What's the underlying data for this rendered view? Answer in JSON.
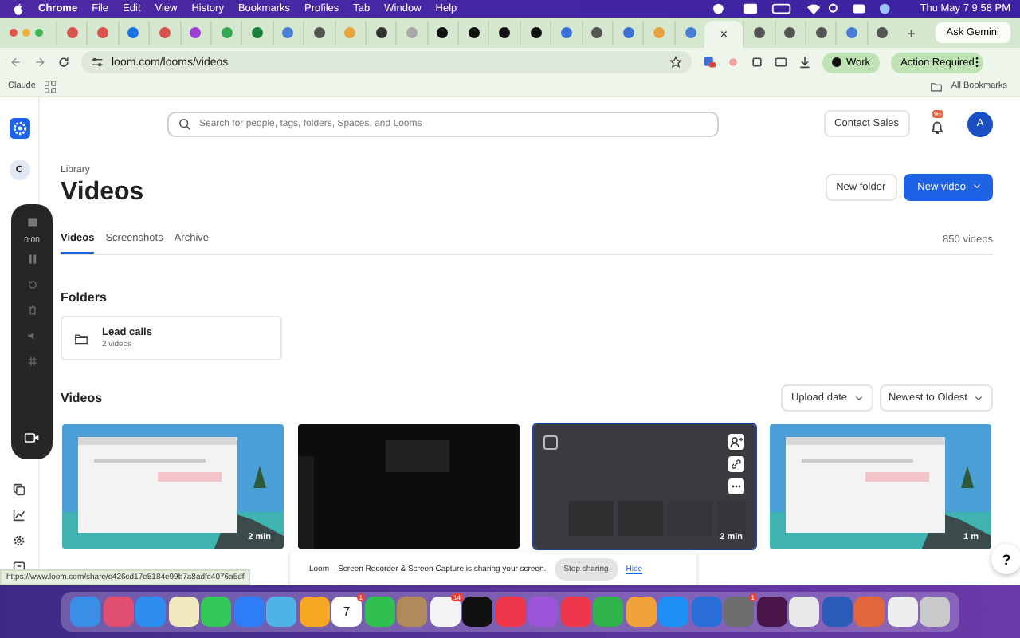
{
  "menu_bar": {
    "app": "Chrome",
    "menus": [
      "File",
      "Edit",
      "View",
      "History",
      "Bookmarks",
      "Profiles",
      "Tab",
      "Window",
      "Help"
    ],
    "clock": "Thu May 7  9:58 PM"
  },
  "tab_strip": {
    "tabs": [
      {
        "color": "#d9534f",
        "selected": false
      },
      {
        "color": "#d9534f",
        "selected": false
      },
      {
        "color": "#1a73e8",
        "selected": false
      },
      {
        "color": "#d9534f",
        "selected": false
      },
      {
        "color": "#9b3fd1",
        "selected": false
      },
      {
        "color": "#34a853",
        "selected": false
      },
      {
        "color": "#188038",
        "selected": false
      },
      {
        "color": "#4a7fd6",
        "selected": false
      },
      {
        "color": "#555555",
        "selected": false
      },
      {
        "color": "#e8a33d",
        "selected": false
      },
      {
        "color": "#333333",
        "selected": false
      },
      {
        "color": "#aaaaaa",
        "selected": false
      },
      {
        "color": "#111111",
        "selected": false
      },
      {
        "color": "#111111",
        "selected": false
      },
      {
        "color": "#111111",
        "selected": false
      },
      {
        "color": "#111111",
        "selected": false
      },
      {
        "color": "#3b6fd6",
        "selected": false
      },
      {
        "color": "#555555",
        "selected": false
      },
      {
        "color": "#3b6fd6",
        "selected": false
      },
      {
        "color": "#e8a33d",
        "selected": false
      },
      {
        "color": "#4a7fd6",
        "selected": false
      },
      {
        "selected": true
      },
      {
        "color": "#555555",
        "selected": false
      },
      {
        "color": "#555555",
        "selected": false
      },
      {
        "color": "#555555",
        "selected": false
      },
      {
        "color": "#4a7fd6",
        "selected": false
      },
      {
        "color": "#555555",
        "selected": false
      }
    ],
    "close": "×",
    "new_tab": "+",
    "ask_gemini": "Ask Gemini"
  },
  "toolbar": {
    "url": "loom.com/looms/videos",
    "profile": "Work",
    "action": "Action Required"
  },
  "bookmarks_bar": {
    "items": [
      "Claude"
    ],
    "all": "All Bookmarks"
  },
  "sidebar": {
    "workspace": "C",
    "recorder_timer": "0:00"
  },
  "header": {
    "search_placeholder": "Search for people, tags, folders, Spaces, and Looms",
    "contact_sales": "Contact Sales",
    "notification_badge": "9+",
    "avatar": "A"
  },
  "library": {
    "eyebrow": "Library",
    "title": "Videos",
    "new_folder": "New folder",
    "new_video": "New video",
    "tabs": [
      {
        "label": "Videos",
        "selected": true
      },
      {
        "label": "Screenshots",
        "selected": false
      },
      {
        "label": "Archive",
        "selected": false
      }
    ],
    "count": "850 videos"
  },
  "folders": {
    "heading": "Folders",
    "items": [
      {
        "name": "Lead calls",
        "count": "2 videos"
      }
    ]
  },
  "videos": {
    "heading": "Videos",
    "sort": [
      "Upload date",
      "Newest to Oldest"
    ],
    "cards": [
      {
        "kind": "desktop",
        "duration": "2 min",
        "selected": false
      },
      {
        "kind": "dark",
        "selected": false
      },
      {
        "kind": "grey",
        "duration": "2 min",
        "selected": true
      },
      {
        "kind": "desktop",
        "duration": "1 m",
        "selected": false
      }
    ]
  },
  "help": "?",
  "status_url": "https://www.loom.com/share/c426cd17e5184e99b7a8adfc4076a5df",
  "sharing_bar": {
    "message": "Loom – Screen Recorder & Screen Capture is sharing your screen.",
    "stop": "Stop sharing",
    "hide": "Hide"
  },
  "dock": {
    "items": [
      {
        "color": "#3a8ee6"
      },
      {
        "color": "#e04f6f"
      },
      {
        "color": "#2f8cf0"
      },
      {
        "color": "#f2e9c0"
      },
      {
        "color": "#34c759"
      },
      {
        "color": "#2f7df6"
      },
      {
        "color": "#4fb3e8"
      },
      {
        "color": "#f5a623"
      },
      {
        "color": "#ffffff",
        "text": "7",
        "badge": "1"
      },
      {
        "color": "#30c04f"
      },
      {
        "color": "#b08a5a"
      },
      {
        "color": "#f4f4f4",
        "badge": "14"
      },
      {
        "color": "#111111"
      },
      {
        "color": "#f0364b"
      },
      {
        "color": "#9b55d8"
      },
      {
        "color": "#f0364b"
      },
      {
        "color": "#2fb34a"
      },
      {
        "color": "#f2a23a"
      },
      {
        "color": "#1e8ff5"
      },
      {
        "color": "#2a6fd8"
      },
      {
        "color": "#6d6d6d",
        "badge": "1"
      },
      {
        "color": "#4a154b"
      },
      {
        "color": "#e9e9e9"
      },
      {
        "color": "#2a5cb8"
      },
      {
        "color": "#e2663c"
      },
      {
        "color": "#eeeeee"
      },
      {
        "color": "#c9c9c9"
      }
    ]
  }
}
